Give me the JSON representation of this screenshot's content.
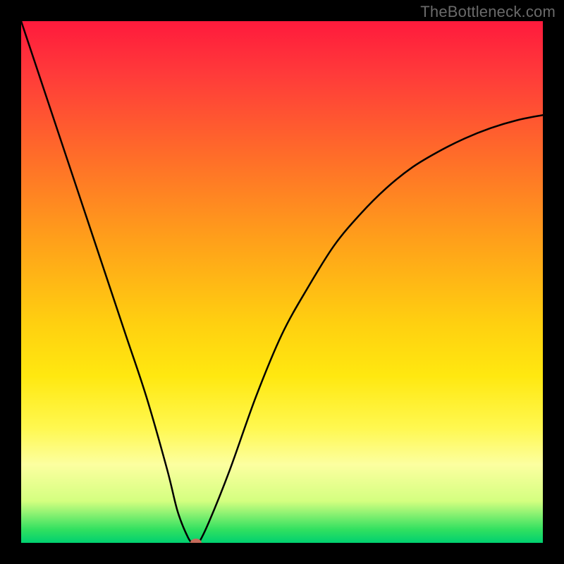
{
  "watermark": {
    "text": "TheBottleneck.com"
  },
  "chart_data": {
    "type": "line",
    "title": "",
    "xlabel": "",
    "ylabel": "",
    "xlim": [
      0,
      100
    ],
    "ylim": [
      0,
      100
    ],
    "grid": false,
    "legend": false,
    "background": "red-green-vertical-gradient",
    "series": [
      {
        "name": "bottleneck-curve",
        "x": [
          0,
          4,
          8,
          12,
          16,
          20,
          24,
          28,
          30,
          32,
          33,
          34,
          36,
          40,
          45,
          50,
          55,
          60,
          65,
          70,
          75,
          80,
          85,
          90,
          95,
          100
        ],
        "values": [
          100,
          88,
          76,
          64,
          52,
          40,
          28,
          14,
          6,
          1,
          0,
          0,
          4,
          14,
          28,
          40,
          49,
          57,
          63,
          68,
          72,
          75,
          77.5,
          79.5,
          81,
          82
        ]
      }
    ],
    "marker": {
      "name": "min-point",
      "x": 33.5,
      "y": 0,
      "color": "#c56a5a",
      "rx": 8,
      "ry": 6
    }
  }
}
